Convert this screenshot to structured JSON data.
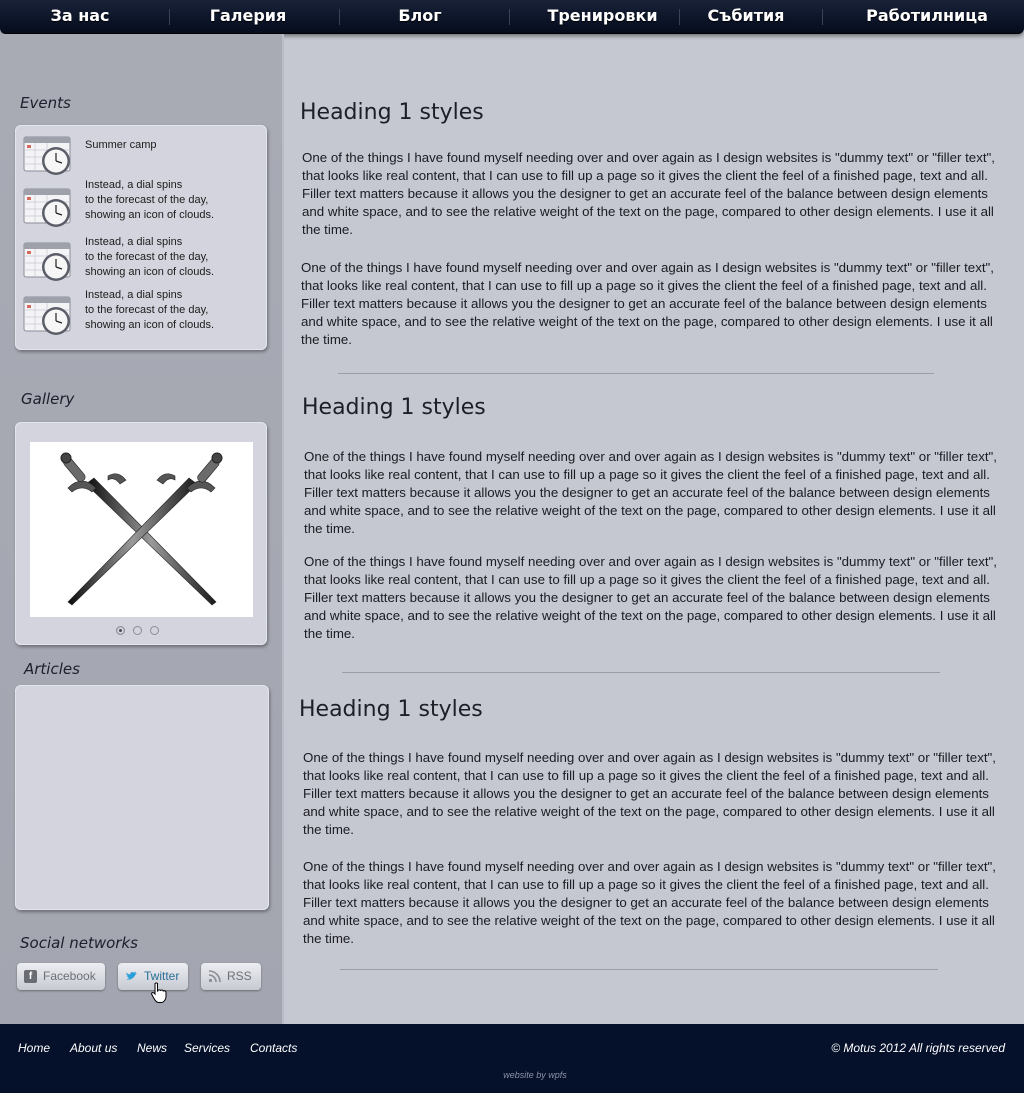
{
  "nav": {
    "items": [
      {
        "label": "За нас"
      },
      {
        "label": "Галерия"
      },
      {
        "label": "Блог"
      },
      {
        "label": "Тренировки"
      },
      {
        "label": "Събития"
      },
      {
        "label": "Работилница"
      }
    ]
  },
  "sidebar": {
    "events_title": "Events",
    "events": [
      {
        "lines": [
          "Summer camp"
        ]
      },
      {
        "lines": [
          "Instead, a dial spins",
          "to the forecast of the day,",
          "showing an icon of clouds."
        ]
      },
      {
        "lines": [
          "Instead, a dial spins",
          "to the forecast of the day,",
          "showing an icon of clouds."
        ]
      },
      {
        "lines": [
          "Instead, a dial spins",
          "to the forecast of the day,",
          "showing an icon of clouds."
        ]
      }
    ],
    "gallery_title": "Gallery",
    "gallery": {
      "slide_count": 3,
      "active_index": 0
    },
    "articles_title": "Articles",
    "social_title": "Social networks",
    "social": {
      "facebook": "Facebook",
      "twitter": "Twitter",
      "rss": "RSS"
    }
  },
  "main": {
    "sections": [
      {
        "heading": "Heading 1 styles",
        "paragraphs": [
          "One of the things I have found myself needing over and over again as I design websites is \"dummy text\" or \"filler text\", that looks like real content, that I can use to fill up a page so it gives the client the feel of a finished page, text and all. Filler text matters because it allows you the designer to get an accurate feel of the balance between design elements and white space, and to see the relative weight of the text on the page, compared to other design elements. I use it all the time.",
          "One of the things I have found myself needing over and over again as I design websites is \"dummy text\" or \"filler text\", that looks like real content, that I can use to fill up a page so it gives the client the feel of a finished page, text and all. Filler text matters because it allows you the designer to get an accurate feel of the balance between design elements and white space, and to see the relative weight of the text on the page, compared to other design elements. I use it all the time."
        ]
      },
      {
        "heading": "Heading 1 styles",
        "paragraphs": [
          "One of the things I have found myself needing over and over again as I design websites is \"dummy text\" or \"filler text\", that looks like real content, that I can use to fill up a page so it gives the client the feel of a finished page, text and all. Filler text matters because it allows you the designer to get an accurate feel of the balance between design elements and white space, and to see the relative weight of the text on the page, compared to other design elements. I use it all the time.",
          "One of the things I have found myself needing over and over again as I design websites is \"dummy text\" or \"filler text\", that looks like real content, that I can use to fill up a page so it gives the client the feel of a finished page, text and all. Filler text matters because it allows you the designer to get an accurate feel of the balance between design elements and white space, and to see the relative weight of the text on the page, compared to other design elements. I use it all the time."
        ]
      },
      {
        "heading": "Heading 1 styles",
        "paragraphs": [
          "One of the things I have found myself needing over and over again as I design websites is \"dummy text\" or \"filler text\", that looks like real content, that I can use to fill up a page so it gives the client the feel of a finished page, text and all. Filler text matters because it allows you the designer to get an accurate feel of the balance between design elements and white space, and to see the relative weight of the text on the page, compared to other design elements. I use it all the time.",
          "One of the things I have found myself needing over and over again as I design websites is \"dummy text\" or \"filler text\", that looks like real content, that I can use to fill up a page so it gives the client the feel of a finished page, text and all. Filler text matters because it allows you the designer to get an accurate feel of the balance between design elements and white space, and to see the relative weight of the text on the page, compared to other design elements. I use it all the time."
        ]
      }
    ]
  },
  "footer": {
    "links": [
      {
        "label": "Home"
      },
      {
        "label": "About us"
      },
      {
        "label": "News"
      },
      {
        "label": "Services"
      },
      {
        "label": "Contacts"
      }
    ],
    "copyright": "© Motus 2012 All rights reserved",
    "credit": "website by wpfs"
  },
  "colors": {
    "nav_bg": "#0c1428",
    "sidebar_bg": "#a8aab4",
    "content_bg": "#c5c7d1",
    "footer_bg": "#05102a",
    "twitter_blue": "#2a9fd8",
    "rss_gray": "#8a8c94",
    "facebook_gray": "#6a6c74"
  },
  "icons": {
    "event_icon": "calendar-clock-icon",
    "facebook": "facebook-icon",
    "twitter": "twitter-bird-icon",
    "rss": "rss-icon",
    "cursor": "hand-pointer-icon"
  }
}
